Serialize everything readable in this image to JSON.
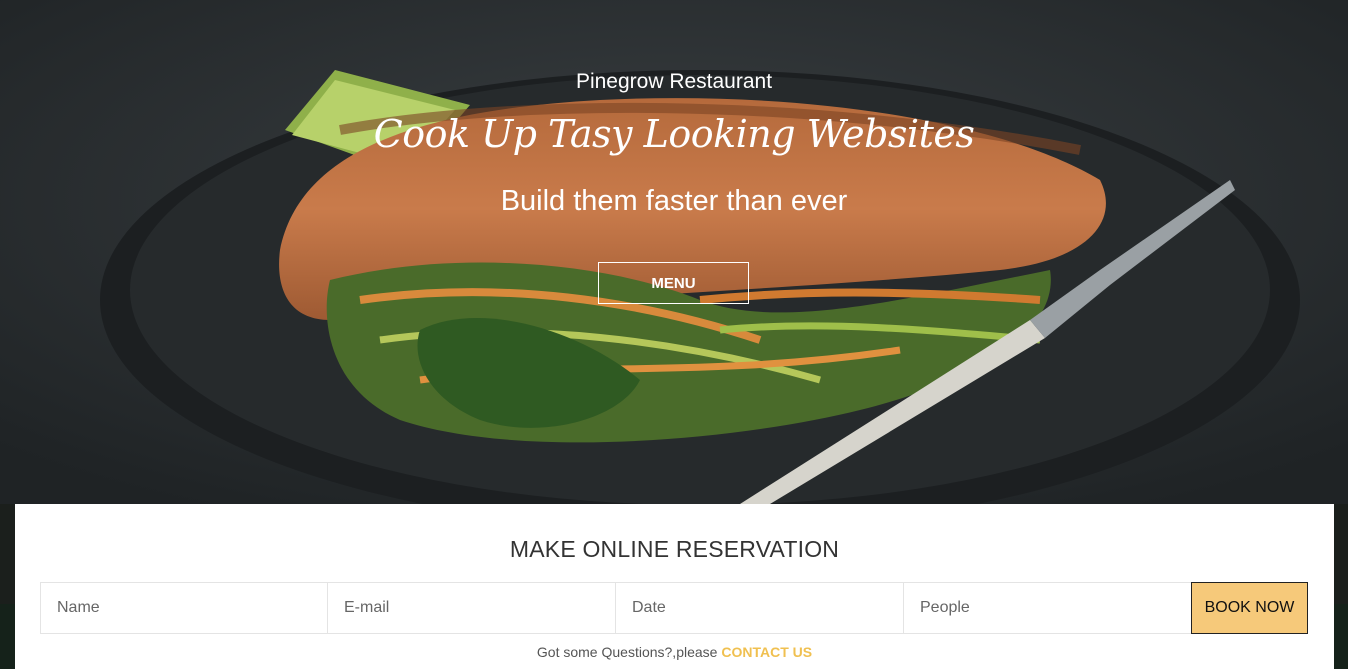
{
  "hero": {
    "brand": "Pinegrow Restaurant",
    "tagline": "Cook Up Tasy Looking Websites",
    "subtitle": "Build them faster than ever",
    "menu_label": "MENU"
  },
  "reservation": {
    "title": "MAKE ONLINE RESERVATION",
    "fields": {
      "name_placeholder": "Name",
      "email_placeholder": "E-mail",
      "date_placeholder": "Date",
      "people_placeholder": "People"
    },
    "book_label": "BOOK NOW",
    "question_text": "Got some Questions?,please",
    "contact_label": "CONTACT US"
  },
  "colors": {
    "accent": "#f6c97a",
    "link": "#f0c050",
    "hero_overlay": "#2c3133"
  }
}
